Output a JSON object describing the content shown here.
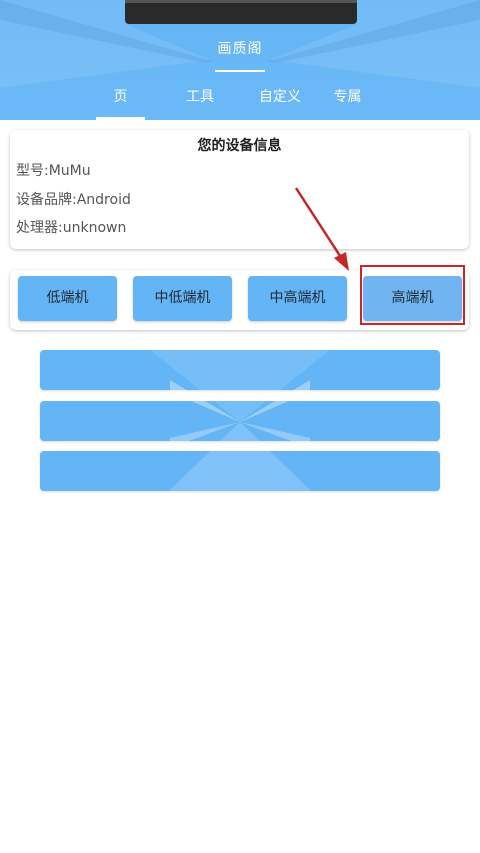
{
  "header": {
    "title": "画质阁",
    "tabs": [
      {
        "label": "页",
        "active": true
      },
      {
        "label": "工具",
        "active": false
      },
      {
        "label": "自定义",
        "active": false
      },
      {
        "label": "专属",
        "active": false
      }
    ]
  },
  "device_info": {
    "title": "您的设备信息",
    "model": "型号:MuMu",
    "brand": "设备品牌:Android",
    "processor": "处理器:unknown"
  },
  "tiers": {
    "low": "低端机",
    "mid_low": "中低端机",
    "mid_high": "中高端机",
    "high": "高端机"
  },
  "colors": {
    "header_blue": "#63b4f6",
    "button_blue": "#64b5f6",
    "annotation_red": "#c62828"
  }
}
